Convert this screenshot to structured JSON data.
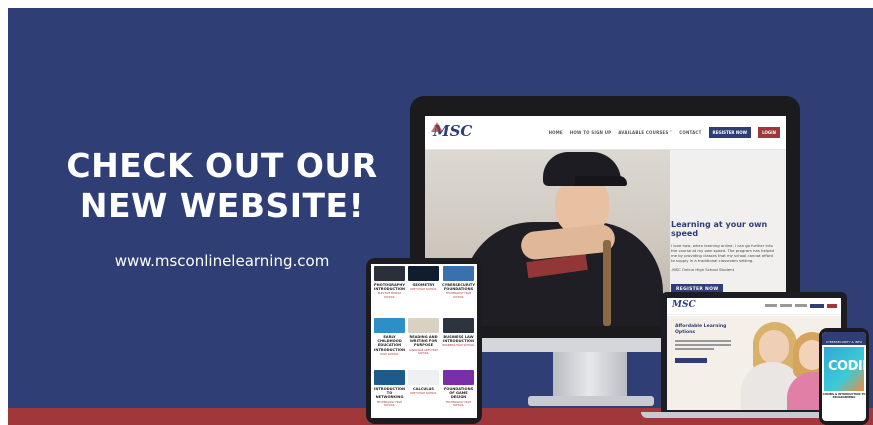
{
  "banner": {
    "headline_line1": "CHECK OUT OUR",
    "headline_line2": "NEW WEBSITE!",
    "url": "www.msconlinelearning.com",
    "colors": {
      "background": "#2f3f75",
      "accent_red": "#a0383b",
      "text": "#ffffff"
    }
  },
  "desktop_site": {
    "logo": "MSC",
    "nav": [
      "HOME",
      "HOW TO SIGN UP",
      "AVAILABLE COURSES ˅",
      "CONTACT"
    ],
    "register_button": "REGISTER NOW",
    "login_button": "LOGIN",
    "hero_title": "Learning at your own speed",
    "hero_text": "I love how, when learning online, I can go further into the course at my own speed. The program has helped me by providing classes that my school cannot afford to supply in a traditional classroom setting.",
    "hero_quote": "-MSC Online High School Student",
    "hero_button": "REGISTER NOW"
  },
  "tablet_site": {
    "courses": [
      {
        "title": "PHOTOGRAPHY INTRODUCTION",
        "sub": "ELECTIVE MIDDLE SCHOOL",
        "thumb": "#2a2f3a"
      },
      {
        "title": "GEOMETRY",
        "sub": "MATH HIGH SCHOOL",
        "thumb": "#0f1d2f"
      },
      {
        "title": "CYBERSECURITY FOUNDATIONS",
        "sub": "TECHNOLOGY HIGH SCHOOL",
        "thumb": "#3a6fb0"
      },
      {
        "title": "EARLY CHILDHOOD EDUCATION INTRODUCTION",
        "sub": "HIGH SCHOOL",
        "thumb": "#2d8fc6"
      },
      {
        "title": "READING AND WRITING FOR PURPOSE",
        "sub": "LANGUAGE ARTS HIGH SCHOOL",
        "thumb": "#e8e4dc"
      },
      {
        "title": "BUSINESS LAW INTRODUCTION",
        "sub": "BUSINESS HIGH SCHOOL",
        "thumb": "#2d3440"
      },
      {
        "title": "INTRODUCTION TO NETWORKING",
        "sub": "TECHNOLOGY HIGH SCHOOL",
        "thumb": "#1d5c8a"
      },
      {
        "title": "CALCULUS",
        "sub": "MATH HIGH SCHOOL",
        "thumb": "#ffffff"
      },
      {
        "title": "FOUNDATIONS OF GAME DESIGN",
        "sub": "TECHNOLOGY HIGH SCHOOL",
        "thumb": "#7a2fa8"
      }
    ]
  },
  "laptop_site": {
    "logo": "MSC",
    "hero_title": "Affordable Learning Options"
  },
  "phone_site": {
    "header": "CYBERSECURITY & INFO",
    "hero_word": "CODIN",
    "course_title": "CODING & INTRODUCTION TO PROGRAMMING"
  }
}
